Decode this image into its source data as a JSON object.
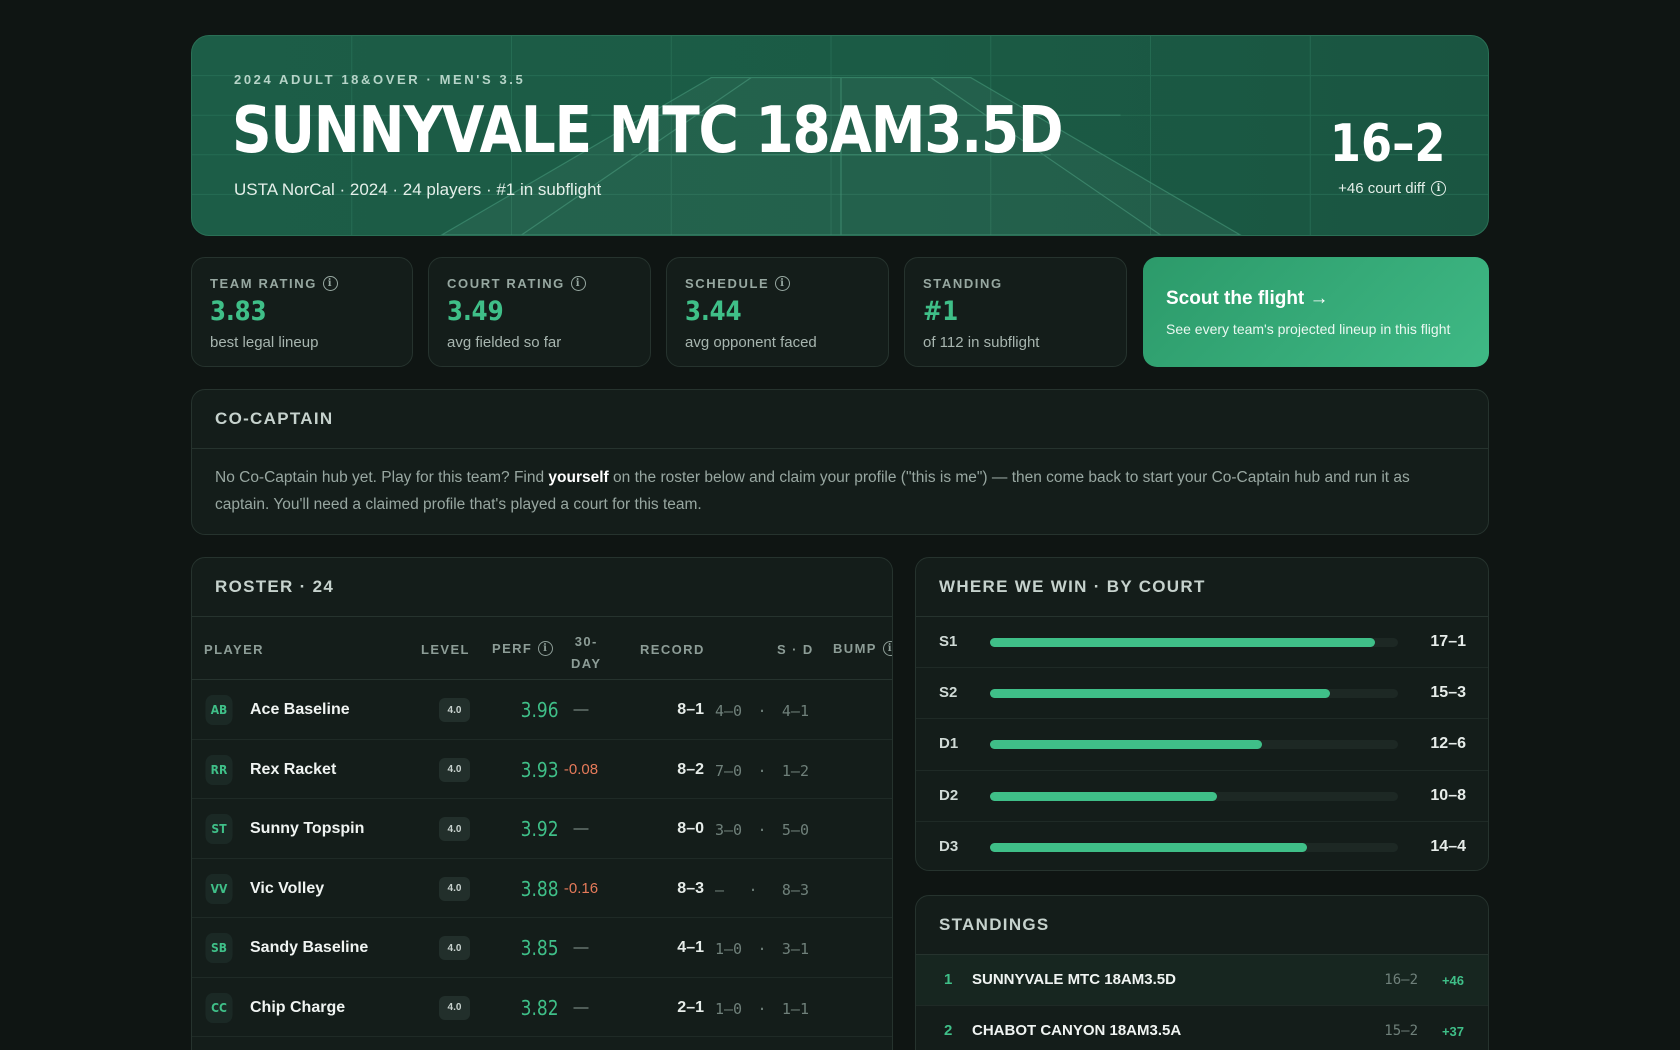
{
  "hero": {
    "eyebrow": "2024 ADULT 18&OVER · MEN'S 3.5",
    "title": "SUNNYVALE MTC 18AM3.5D",
    "subtitle": "USTA NorCal · 2024 · 24 players · #1 in subflight",
    "record": "16–2",
    "court_diff": "+46 court diff"
  },
  "stats": [
    {
      "label": "TEAM RATING",
      "value": "3.83",
      "note": "best legal lineup",
      "info": true
    },
    {
      "label": "COURT RATING",
      "value": "3.49",
      "note": "avg fielded so far",
      "info": true
    },
    {
      "label": "SCHEDULE",
      "value": "3.44",
      "note": "avg opponent faced",
      "info": true
    },
    {
      "label": "STANDING",
      "value": "#1",
      "note": "of 112 in subflight",
      "info": false
    }
  ],
  "scout": {
    "title": "Scout the flight →",
    "desc": "See every team's projected lineup in this flight"
  },
  "cocaptain": {
    "heading": "CO-CAPTAIN",
    "text_before": "No Co-Captain hub yet. Play for this team? Find ",
    "text_bold": "yourself",
    "text_after": " on the roster below and claim your profile (\"this is me\") — then come back to start your Co-Captain hub and run it as captain. You'll need a claimed profile that's played a court for this team."
  },
  "roster": {
    "heading": "ROSTER · 24",
    "columns": {
      "player": "PLAYER",
      "level": "LEVEL",
      "perf": "PERF",
      "day30_a": "30-",
      "day30_b": "DAY",
      "record": "RECORD",
      "sd": "S · D",
      "bump": "BUMP"
    },
    "rows": [
      {
        "initials": "AB",
        "name": "Ace Baseline",
        "level": "4.0",
        "perf": "3.96",
        "d30": "—",
        "record": "8–1",
        "s": "4–0",
        "dot": "·",
        "d": "4–1"
      },
      {
        "initials": "RR",
        "name": "Rex Racket",
        "level": "4.0",
        "perf": "3.93",
        "d30": "-0.08",
        "record": "8–2",
        "s": "7–0",
        "dot": "·",
        "d": "1–2"
      },
      {
        "initials": "ST",
        "name": "Sunny Topspin",
        "level": "4.0",
        "perf": "3.92",
        "d30": "—",
        "record": "8–0",
        "s": "3–0",
        "dot": "·",
        "d": "5–0"
      },
      {
        "initials": "VV",
        "name": "Vic Volley",
        "level": "4.0",
        "perf": "3.88",
        "d30": "-0.16",
        "record": "8–3",
        "s": "—",
        "dot": "·",
        "d": "8–3"
      },
      {
        "initials": "SB",
        "name": "Sandy Baseline",
        "level": "4.0",
        "perf": "3.85",
        "d30": "—",
        "record": "4–1",
        "s": "1–0",
        "dot": "·",
        "d": "3–1"
      },
      {
        "initials": "CC",
        "name": "Chip Charge",
        "level": "4.0",
        "perf": "3.82",
        "d30": "—",
        "record": "2–1",
        "s": "1–0",
        "dot": "·",
        "d": "1–1"
      }
    ]
  },
  "where_we_win": {
    "heading": "WHERE WE WIN · BY COURT",
    "courts": [
      {
        "court": "S1",
        "record": "17–1",
        "win_pct": 0.944
      },
      {
        "court": "S2",
        "record": "15–3",
        "win_pct": 0.833
      },
      {
        "court": "D1",
        "record": "12–6",
        "win_pct": 0.667
      },
      {
        "court": "D2",
        "record": "10–8",
        "win_pct": 0.556
      },
      {
        "court": "D3",
        "record": "14–4",
        "win_pct": 0.778
      }
    ]
  },
  "standings": {
    "heading": "STANDINGS",
    "rows": [
      {
        "rank": "1",
        "team": "SUNNYVALE MTC 18AM3.5D",
        "record": "16–2",
        "diff": "+46"
      },
      {
        "rank": "2",
        "team": "CHABOT CANYON 18AM3.5A",
        "record": "15–2",
        "diff": "+37"
      }
    ]
  },
  "colors": {
    "accent": "#3fbf88",
    "negative": "#e57a5a",
    "hero_bg": "#1c5d47"
  }
}
